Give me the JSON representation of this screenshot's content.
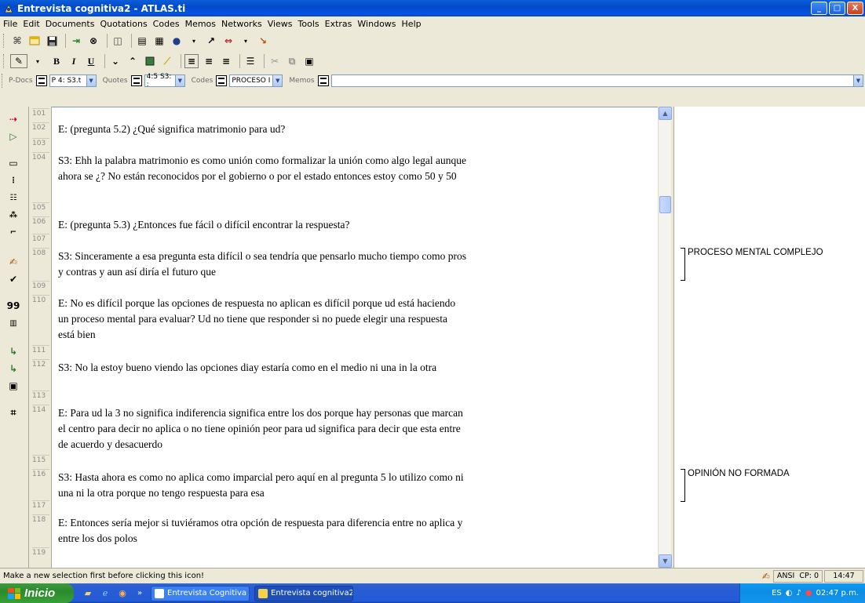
{
  "window": {
    "title": "Entrevista cognitiva2 - ATLAS.ti",
    "min": "_",
    "max": "□",
    "close": "X"
  },
  "menu": [
    "File",
    "Edit",
    "Documents",
    "Quotations",
    "Codes",
    "Memos",
    "Networks",
    "Views",
    "Tools",
    "Extras",
    "Windows",
    "Help"
  ],
  "format_toolbar": {
    "bold": "B",
    "italic": "I",
    "underline": "U"
  },
  "selectors": {
    "pdocs_label": "P-Docs",
    "pdocs_value": "P 4: S3.t",
    "quotes_label": "Quotes",
    "quotes_value": "4:5 S3: :",
    "codes_label": "Codes",
    "codes_value": "PROCESO I",
    "memos_label": "Memos"
  },
  "left_toolbar": {
    "quote_count": "99"
  },
  "line_numbers": [
    "101",
    "102",
    "103",
    "104",
    "105",
    "106",
    "107",
    "108",
    "109",
    "110",
    "111",
    "112",
    "113",
    "114",
    "115",
    "116",
    "117",
    "118",
    "119"
  ],
  "document": {
    "paragraphs": [
      "E: (pregunta 5.2) ¿Qué significa matrimonio para ud?",
      "S3: Ehh la palabra matrimonio es como unión como formalizar la unión como algo legal aunque ahora se ¿? No están reconocidos por el gobierno o por el estado entonces estoy como 50 y 50",
      "E: (pregunta 5.3) ¿Entonces fue fácil o difícil encontrar la respuesta?",
      "S3: Sinceramente a esa pregunta esta difícil o sea tendría que pensarlo mucho tiempo como pros y contras y aun así diría el futuro que",
      "E: No es difícil porque las opciones de respuesta no aplican es difícil porque ud está haciendo un proceso mental para evaluar? Ud no tiene que responder si no puede elegir una respuesta está bien",
      "S3: No la estoy bueno viendo las opciones diay estaría como en el medio ni una in la otra",
      "E: Para ud la 3 no significa indiferencia significa entre los dos porque hay personas que marcan el centro para decir no aplica o no tiene opinión peor para ud significa para decir que esta entre de acuerdo y desacuerdo",
      "S3: Hasta ahora es como no aplica como imparcial pero aquí en al pregunta 5 lo utilizo como ni una ni la otra porque no tengo respuesta para esa",
      "E: Entonces sería mejor si tuviéramos otra opción de respuesta para diferencia entre no aplica y entre los dos polos"
    ]
  },
  "codes": [
    "PROCESO MENTAL COMPLEJO",
    "OPINIÓN NO FORMADA"
  ],
  "status": {
    "message": "Make a new selection first before clicking this icon!",
    "encoding": "ANSI",
    "cp": "CP: 0",
    "time": "14:47"
  },
  "taskbar": {
    "start": "Inicio",
    "tasks": [
      "Entrevista Cognitiva ...",
      "Entrevista cognitiva2 ..."
    ],
    "lang": "ES",
    "clock": "02:47 p.m."
  }
}
